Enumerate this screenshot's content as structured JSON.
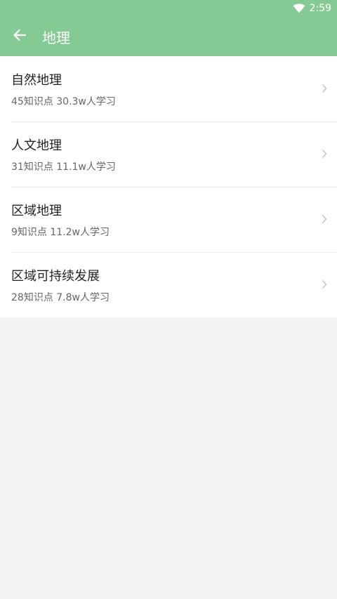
{
  "status_bar": {
    "time": "2:59",
    "wifi_icon": "wifi-icon"
  },
  "app_bar": {
    "back_icon": "arrow-left-icon",
    "title": "地理"
  },
  "items": [
    {
      "title": "自然地理",
      "subtitle": "45知识点 30.3w人学习"
    },
    {
      "title": "人文地理",
      "subtitle": "31知识点 11.1w人学习"
    },
    {
      "title": "区域地理",
      "subtitle": "9知识点 11.2w人学习"
    },
    {
      "title": "区域可持续发展",
      "subtitle": "28知识点 7.8w人学习"
    }
  ],
  "colors": {
    "primary": "#85c994",
    "background": "#f3f3f5"
  }
}
